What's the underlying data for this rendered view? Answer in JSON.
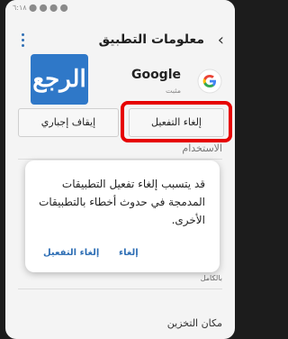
{
  "statusbar": {
    "left_text": "٦:١٨ ⬤ ⬤ ⬤ ⬤"
  },
  "appbar": {
    "title": "معلومات التطبيق",
    "back_icon": "chevron-left-icon",
    "more_icon": "more-vertical-icon"
  },
  "watermark": {
    "text": "الرجع"
  },
  "app": {
    "name": "Google",
    "status": "مثبت",
    "icon": "google-icon"
  },
  "actions": {
    "disable_label": "إلغاء التفعيل",
    "force_stop_label": "إيقاف إجباري"
  },
  "sections": {
    "usage": "الاستخدام",
    "storage": "مكان التخزين",
    "fully_label": "بالكامل"
  },
  "dialog": {
    "message": "قد يتسبب إلغاء تفعيل التطبيقات المدمجة في حدوث أخطاء بالتطبيقات الأخرى.",
    "cancel_label": "إلغاء",
    "disable_label": "إلغاء التفعيل"
  },
  "colors": {
    "accent": "#2f6fb5",
    "highlight": "#e60000"
  }
}
